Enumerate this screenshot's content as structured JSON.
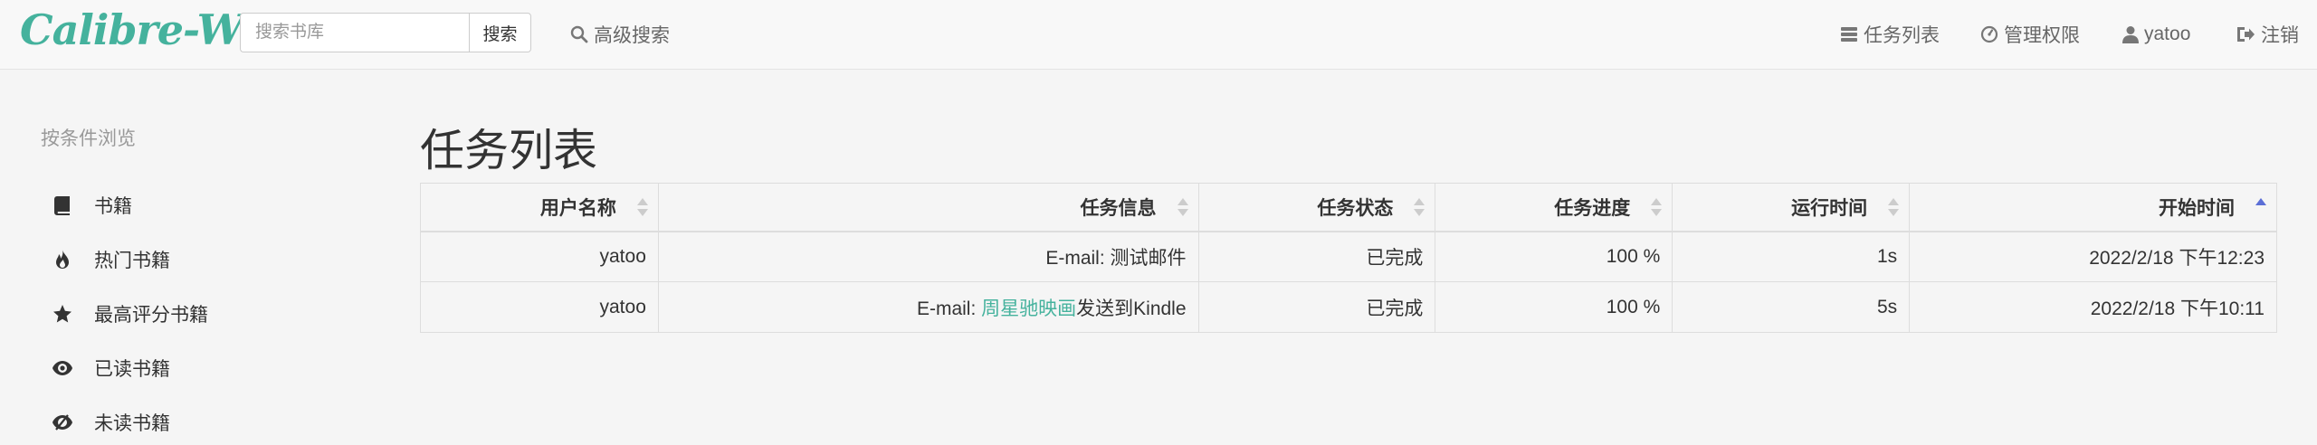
{
  "brand": "Calibre-Web",
  "search": {
    "placeholder": "搜索书库",
    "button": "搜索"
  },
  "nav": {
    "advanced_search": "高级搜索",
    "task_list": "任务列表",
    "admin": "管理权限",
    "user": "yatoo",
    "logout": "注销"
  },
  "sidebar": {
    "title": "按条件浏览",
    "items": [
      {
        "label": "书籍",
        "icon": "book-icon"
      },
      {
        "label": "热门书籍",
        "icon": "fire-icon"
      },
      {
        "label": "最高评分书籍",
        "icon": "star-icon"
      },
      {
        "label": "已读书籍",
        "icon": "eye-icon"
      },
      {
        "label": "未读书籍",
        "icon": "eye-slash-icon"
      }
    ]
  },
  "main": {
    "title": "任务列表",
    "columns": [
      "用户名称",
      "任务信息",
      "任务状态",
      "任务进度",
      "运行时间",
      "开始时间"
    ],
    "rows": [
      {
        "user": "yatoo",
        "info_prefix": "E-mail: 测试邮件",
        "info_link": "",
        "info_suffix": "",
        "status": "已完成",
        "progress": "100 %",
        "runtime": "1s",
        "start": "2022/2/18 下午12:23"
      },
      {
        "user": "yatoo",
        "info_prefix": "E-mail: ",
        "info_link": "周星驰映画",
        "info_suffix": "发送到Kindle",
        "status": "已完成",
        "progress": "100 %",
        "runtime": "5s",
        "start": "2022/2/18 下午10:11"
      }
    ]
  },
  "colors": {
    "brand": "#45b29d",
    "sort_active": "#5b6fd6",
    "sort_inactive": "#cccccc"
  }
}
